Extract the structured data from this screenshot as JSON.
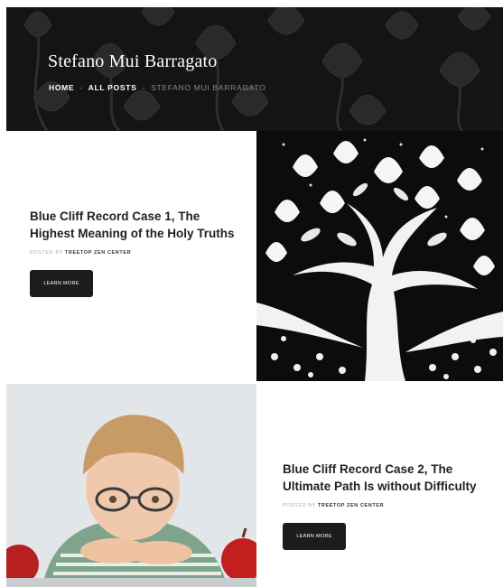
{
  "header": {
    "site_title": "Stefano Mui Barragato",
    "breadcrumb": [
      {
        "label": "Home"
      },
      {
        "label": "All Posts"
      },
      {
        "label": "Stefano Mui Barragato"
      }
    ],
    "separator": "-"
  },
  "posts": [
    {
      "title": "Blue Cliff Record Case 1, The Highest Meaning of the Holy Truths",
      "posted_by_label": "Posted by",
      "author": "Treetop Zen Center",
      "button_label": "Learn More",
      "image": "tree-of-hearts-woodcut"
    },
    {
      "title": "Blue Cliff Record Case 2, The Ultimate Path Is without Difficulty",
      "posted_by_label": "Posted by",
      "author": "Treetop Zen Center",
      "button_label": "Learn More",
      "image": "boy-with-glasses-and-apples"
    }
  ],
  "colors": {
    "banner_bg": "#141414",
    "button_bg": "#1c1c1c",
    "text_dark": "#222222",
    "meta_grey": "#aaaaaa"
  }
}
